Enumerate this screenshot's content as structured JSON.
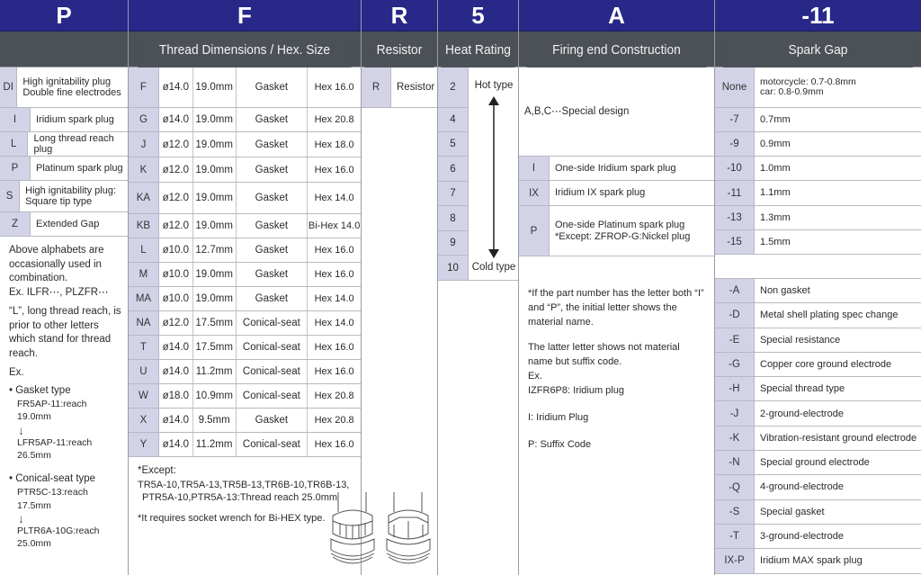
{
  "columns": {
    "p": {
      "letter": "P",
      "subtitle": "",
      "rows": [
        {
          "code": "DI",
          "desc": "High ignitability plug Double fine electrodes"
        },
        {
          "code": "I",
          "desc": "Iridium spark plug"
        },
        {
          "code": "L",
          "desc": "Long thread reach plug"
        },
        {
          "code": "P",
          "desc": "Platinum spark plug"
        },
        {
          "code": "S",
          "desc": "High ignitability plug: Square tip type"
        },
        {
          "code": "Z",
          "desc": "Extended Gap"
        }
      ],
      "note": {
        "para1": "Above alphabets are occasionally used in combination.",
        "para1_ex": "Ex. ILFR⋯, PLZFR⋯",
        "para2": "“L”, long thread reach, is prior to other letters which stand for thread reach.",
        "ex_label": "Ex.",
        "gasket_title": "• Gasket type",
        "gasket_from": "FR5AP-11:reach 19.0mm",
        "gasket_to": "LFR5AP-11:reach 26.5mm",
        "conical_title": "• Conical-seat type",
        "conical_from": "PTR5C-13:reach 17.5mm",
        "conical_to": "PLTR6A-10G:reach 25.0mm",
        "arrow": "↓"
      }
    },
    "f": {
      "letter": "F",
      "subtitle": "Thread Dimensions / Hex. Size",
      "rows": [
        {
          "code": "F",
          "dia": "ø14.0",
          "reach": "19.0mm",
          "seat": "Gasket",
          "hex": "Hex 16.0"
        },
        {
          "code": "G",
          "dia": "ø14.0",
          "reach": "19.0mm",
          "seat": "Gasket",
          "hex": "Hex 20.8"
        },
        {
          "code": "J",
          "dia": "ø12.0",
          "reach": "19.0mm",
          "seat": "Gasket",
          "hex": "Hex 18.0"
        },
        {
          "code": "K",
          "dia": "ø12.0",
          "reach": "19.0mm",
          "seat": "Gasket",
          "hex": "Hex 16.0"
        },
        {
          "code": "KA",
          "dia": "ø12.0",
          "reach": "19.0mm",
          "seat": "Gasket",
          "hex": "Hex 14.0"
        },
        {
          "code": "KB",
          "dia": "ø12.0",
          "reach": "19.0mm",
          "seat": "Gasket",
          "hex": "Bi-Hex 14.0"
        },
        {
          "code": "L",
          "dia": "ø10.0",
          "reach": "12.7mm",
          "seat": "Gasket",
          "hex": "Hex 16.0"
        },
        {
          "code": "M",
          "dia": "ø10.0",
          "reach": "19.0mm",
          "seat": "Gasket",
          "hex": "Hex 16.0"
        },
        {
          "code": "MA",
          "dia": "ø10.0",
          "reach": "19.0mm",
          "seat": "Gasket",
          "hex": "Hex 14.0"
        },
        {
          "code": "NA",
          "dia": "ø12.0",
          "reach": "17.5mm",
          "seat": "Conical-seat",
          "hex": "Hex 14.0"
        },
        {
          "code": "T",
          "dia": "ø14.0",
          "reach": "17.5mm",
          "seat": "Conical-seat",
          "hex": "Hex 16.0"
        },
        {
          "code": "U",
          "dia": "ø14.0",
          "reach": "11.2mm",
          "seat": "Conical-seat",
          "hex": "Hex 16.0"
        },
        {
          "code": "W",
          "dia": "ø18.0",
          "reach": "10.9mm",
          "seat": "Conical-seat",
          "hex": "Hex 20.8"
        },
        {
          "code": "X",
          "dia": "ø14.0",
          "reach": "9.5mm",
          "seat": "Gasket",
          "hex": "Hex 20.8"
        },
        {
          "code": "Y",
          "dia": "ø14.0",
          "reach": "11.2mm",
          "seat": "Conical-seat",
          "hex": "Hex 16.0"
        }
      ],
      "note": {
        "except_label": "*Except:",
        "except_line1": "TR5A-10,TR5A-13,TR5B-13,TR6B-10,TR6B-13,",
        "except_line2": "PTR5A-10,PTR5A-13:Thread reach 25.0mm",
        "bihex": "*It requires socket wrench for Bi-HEX type."
      }
    },
    "r": {
      "letter": "R",
      "subtitle": "Resistor",
      "rows": [
        {
          "code": "R",
          "desc": "Resistor"
        }
      ]
    },
    "heat": {
      "letter": "5",
      "subtitle": "Heat Rating",
      "codes": [
        "2",
        "4",
        "5",
        "6",
        "7",
        "8",
        "9",
        "10"
      ],
      "hot_label": "Hot type",
      "cold_label": "Cold type"
    },
    "a": {
      "letter": "A",
      "subtitle": "Firing end Construction",
      "special": "A,B,C⋯Special design",
      "rows": [
        {
          "code": "I",
          "desc": "One-side Iridium spark plug"
        },
        {
          "code": "IX",
          "desc": "Iridium IX spark plug"
        },
        {
          "code": "P",
          "desc": "One-side Platinum spark plug",
          "desc2": "*Except: ZFROP-G:Nickel plug"
        }
      ],
      "note": {
        "line1": "*If the part number has the letter both “I” and “P”, the initial letter shows the material name.",
        "line2": "The latter letter shows not material name but suffix code.",
        "ex": "Ex.",
        "example": "IZFR6P8: Iridium plug",
        "i_meaning": "I: Iridium Plug",
        "p_meaning": "P: Suffix Code"
      }
    },
    "gap": {
      "letter": "-11",
      "subtitle": "Spark Gap",
      "gap_rows": [
        {
          "code": "None",
          "desc": "motorcycle: 0.7-0.8mm",
          "desc2": "car: 0.8-0.9mm"
        },
        {
          "code": "-7",
          "desc": "0.7mm"
        },
        {
          "code": "-9",
          "desc": "0.9mm"
        },
        {
          "code": "-10",
          "desc": "1.0mm"
        },
        {
          "code": "-11",
          "desc": "1.1mm"
        },
        {
          "code": "-13",
          "desc": "1.3mm"
        },
        {
          "code": "-15",
          "desc": "1.5mm"
        }
      ],
      "suffix_rows": [
        {
          "code": "-A",
          "desc": "Non gasket"
        },
        {
          "code": "-D",
          "desc": "Metal shell plating spec change"
        },
        {
          "code": "-E",
          "desc": "Special resistance"
        },
        {
          "code": "-G",
          "desc": "Copper core ground electrode"
        },
        {
          "code": "-H",
          "desc": "Special thread type"
        },
        {
          "code": "-J",
          "desc": "2-ground-electrode"
        },
        {
          "code": "-K",
          "desc": "Vibration-resistant ground electrode"
        },
        {
          "code": "-N",
          "desc": "Special ground electrode"
        },
        {
          "code": "-Q",
          "desc": "4-ground-electrode"
        },
        {
          "code": "-S",
          "desc": "Special gasket"
        },
        {
          "code": "-T",
          "desc": "3-ground-electrode"
        },
        {
          "code": "IX-P",
          "desc": "Iridium MAX spark plug"
        }
      ]
    }
  },
  "colors": {
    "header_primary": "#272888",
    "header_secondary": "#4c5157",
    "code_cell": "#d3d3e8"
  }
}
